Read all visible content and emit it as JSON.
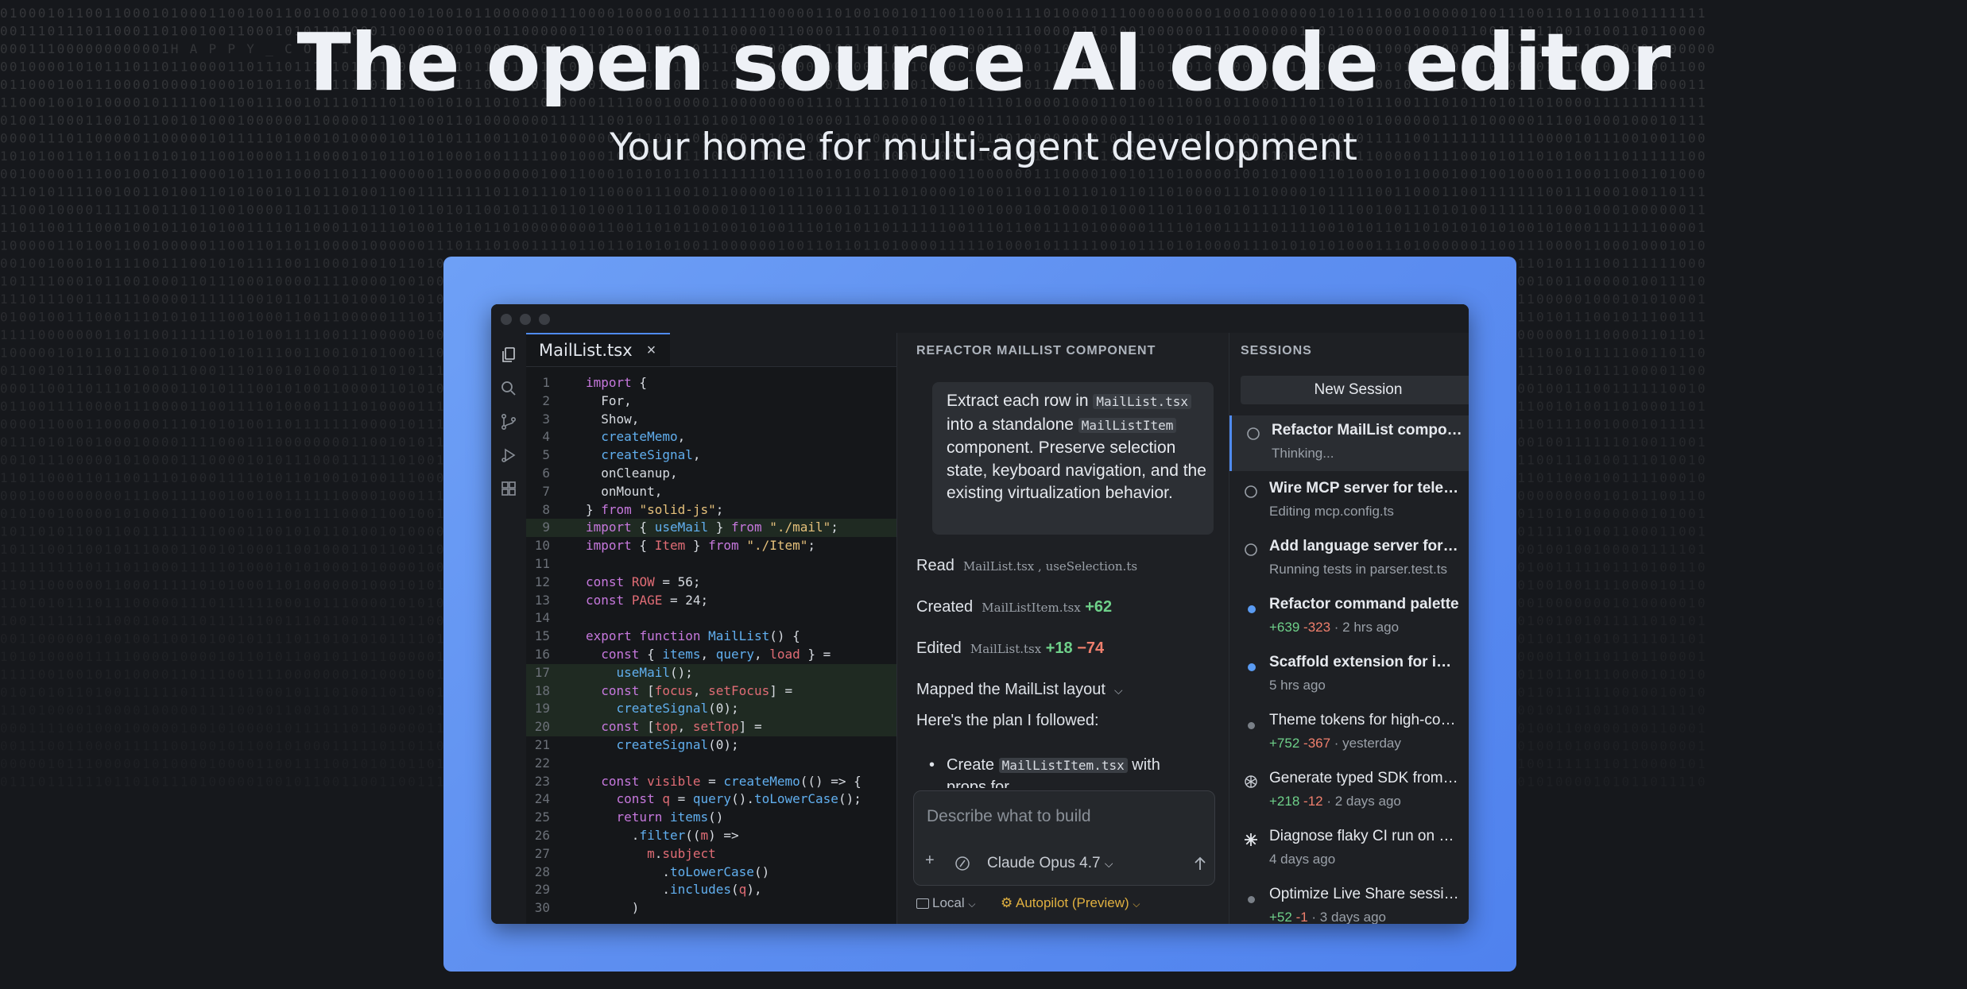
{
  "hero": {
    "title": "The open source AI code editor",
    "subtitle": "Your home for multi-agent development"
  },
  "background": {
    "easter_egg": "HAPPY_CODING"
  },
  "editor": {
    "tab_label": "MailList.tsx",
    "tab_close": "×",
    "line_numbers": [
      "1",
      "2",
      "3",
      "4",
      "5",
      "6",
      "7",
      "8",
      "9",
      "10",
      "11",
      "12",
      "13",
      "14",
      "15",
      "16",
      "17",
      "18",
      "19",
      "20",
      "21",
      "22",
      "23",
      "24",
      "25",
      "26",
      "27",
      "28",
      "29",
      "30"
    ],
    "lines": [
      "import {",
      "  For,",
      "  Show,",
      "  createMemo,",
      "  createSignal,",
      "  onCleanup,",
      "  onMount,",
      "} from \"solid-js\";",
      "import { useMail } from \"./mail\";",
      "import { Item } from \"./Item\";",
      "",
      "const ROW = 56;",
      "const PAGE = 24;",
      "",
      "export function MailList() {",
      "  const { items, query, load } =",
      "    useMail();",
      "  const [focus, setFocus] =",
      "    createSignal(0);",
      "  const [top, setTop] =",
      "    createSignal(0);",
      "",
      "  const visible = createMemo(() => {",
      "    const q = query().toLowerCase();",
      "    return items()",
      "      .filter((m) =>",
      "        m.subject",
      "          .toLowerCase()",
      "          .includes(q),",
      "      )"
    ]
  },
  "chat": {
    "header": "REFACTOR MAILLIST COMPONENT",
    "user_message": {
      "part1": "Extract each row in ",
      "code1": "MailList.tsx",
      "part2": " into a standalone ",
      "code2": "MailListItem",
      "part3": " component. Preserve selection state, keyboard navigation, and the existing virtualization behavior."
    },
    "read_label": "Read",
    "read_files": "MailList.tsx , useSelection.ts",
    "created_label": "Created",
    "created_file": "MailListItem.tsx",
    "created_plus": "+62",
    "edited_label": "Edited",
    "edited_file": "MailList.tsx",
    "edited_plus": "+18",
    "edited_minus": "−74",
    "mapped_label": "Mapped the MailList layout",
    "plan_text": "Here's the plan I followed:",
    "bullet_prefix": "Create ",
    "bullet_code": "MailListItem.tsx",
    "bullet_suffix": " with",
    "bullet_cont": "props for",
    "input_placeholder": "Describe what to build",
    "model": "Claude Opus 4.7",
    "location": "Local",
    "mode": "Autopilot (Preview)"
  },
  "sessions": {
    "header": "SESSIONS",
    "new_session": "New Session",
    "items": [
      {
        "title": "Refactor MailList component",
        "plus": "",
        "minus": "",
        "sub": "Thinking..."
      },
      {
        "title": "Wire MCP server for telemetry",
        "plus": "",
        "minus": "",
        "sub": "Editing mcp.config.ts"
      },
      {
        "title": "Add language server for parser",
        "plus": "",
        "minus": "",
        "sub": "Running tests in parser.test.ts"
      },
      {
        "title": "Refactor command palette",
        "plus": "+639",
        "minus": "-323",
        "sub": " · 2 hrs ago"
      },
      {
        "title": "Scaffold extension for inline",
        "plus": "",
        "minus": "",
        "sub": "5 hrs ago"
      },
      {
        "title": "Theme tokens for high-contrast",
        "plus": "+752",
        "minus": "-367",
        "sub": " · yesterday"
      },
      {
        "title": "Generate typed SDK from OpenAPI",
        "plus": "+218",
        "minus": "-12",
        "sub": " · 2 days ago"
      },
      {
        "title": "Diagnose flaky CI run on main",
        "plus": "",
        "minus": "",
        "sub": "4 days ago"
      },
      {
        "title": "Optimize Live Share session",
        "plus": "+52",
        "minus": "-1",
        "sub": " · 3 days ago"
      }
    ]
  },
  "colors": {
    "accent": "#4f8bf0",
    "panel": "#5e8ff0",
    "added": "#6fd18a",
    "removed": "#ef7f6d",
    "autopilot": "#e0b040"
  }
}
